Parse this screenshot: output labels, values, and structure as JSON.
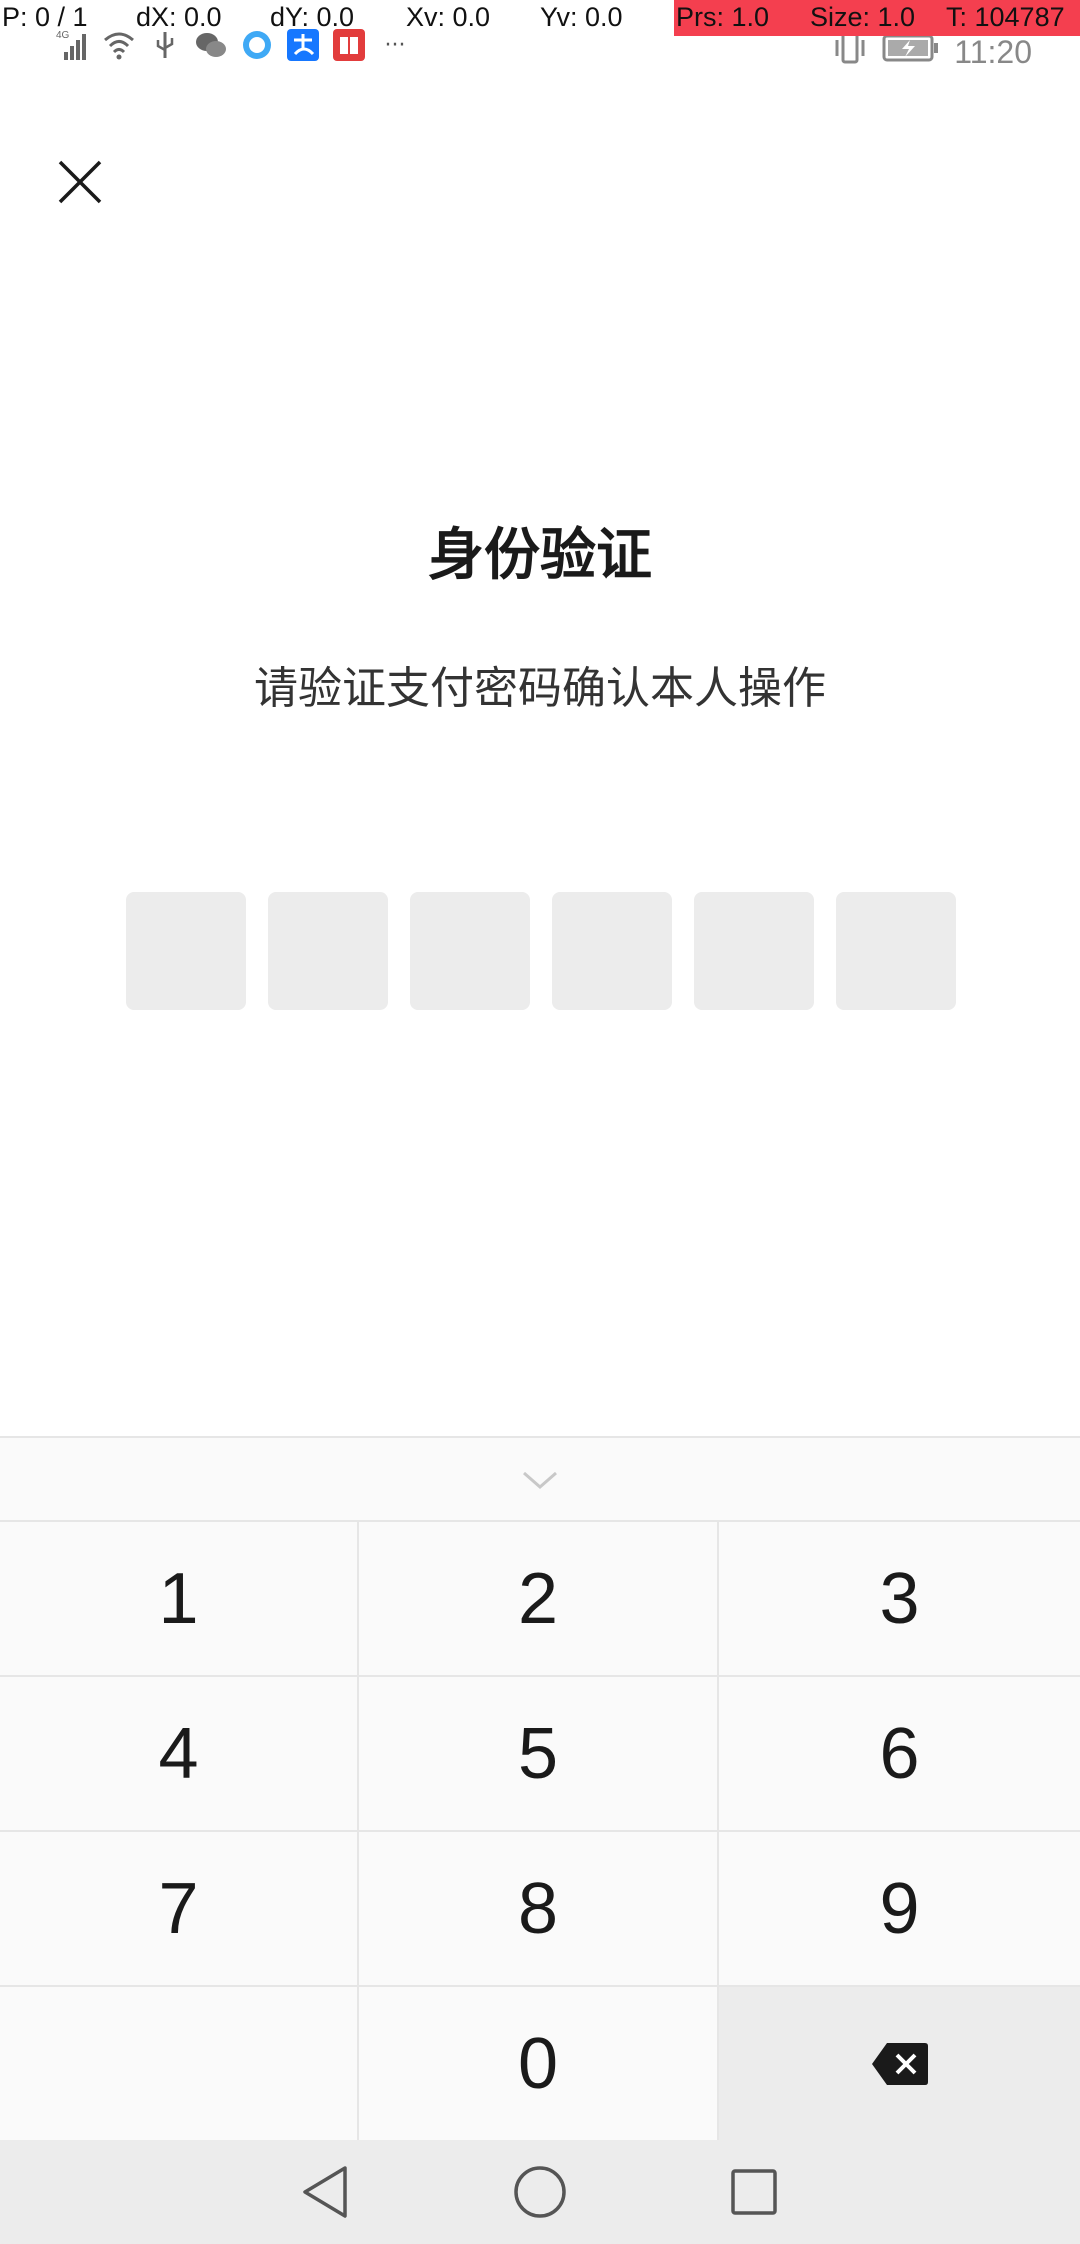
{
  "debug": {
    "pointer": "P: 0 / 1",
    "dx": "dX: 0.0",
    "dy": "dY: 0.0",
    "xv": "Xv: 0.0",
    "yv": "Yv: 0.0",
    "prs": "Prs: 1.0",
    "size": "Size: 1.0",
    "time": "T: 104787",
    "highlight_color": "#f43f4f"
  },
  "status_bar": {
    "network_label": "4G",
    "more": "···",
    "clock": "11:20",
    "icons": [
      "signal-icon",
      "wifi-icon",
      "usb-icon",
      "wechat-icon",
      "browser-icon",
      "alipay-icon",
      "book-icon",
      "vibrate-icon",
      "battery-icon"
    ]
  },
  "header": {
    "close_icon": "close-icon"
  },
  "main": {
    "title": "身份验证",
    "subtitle": "请验证支付密码确认本人操作",
    "pin_length": 6
  },
  "keyboard": {
    "collapse_icon": "chevron-down-icon",
    "keys": [
      "1",
      "2",
      "3",
      "4",
      "5",
      "6",
      "7",
      "8",
      "9",
      "",
      "0",
      "delete"
    ],
    "delete_icon": "backspace-icon"
  },
  "nav": {
    "icons": [
      "back-icon",
      "home-icon",
      "recents-icon"
    ]
  }
}
